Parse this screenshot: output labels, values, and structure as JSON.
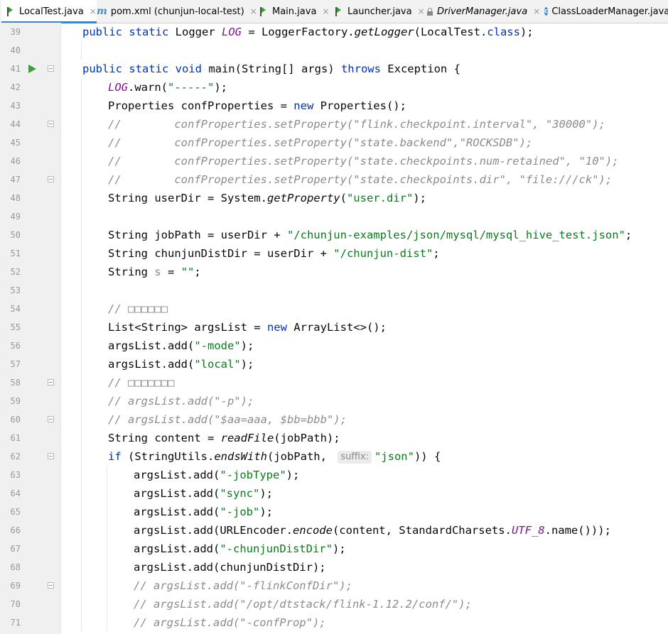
{
  "tabs": [
    {
      "label": "LocalTest.java",
      "icon": "java-class-icon",
      "active": true
    },
    {
      "label": "pom.xml (chunjun-local-test)",
      "icon": "maven-icon"
    },
    {
      "label": "Main.java",
      "icon": "java-class-icon"
    },
    {
      "label": "Launcher.java",
      "icon": "java-class-icon"
    },
    {
      "label": "DriverManager.java",
      "icon": "read-only-lock-icon"
    },
    {
      "label": "ClassLoaderManager.java",
      "icon": "class-icon"
    }
  ],
  "tab_close_glyph": "×",
  "code_lines": [
    {
      "n": "39",
      "t": [
        [
          "kw",
          "public static "
        ],
        [
          "plain",
          "Logger "
        ],
        [
          "fld",
          "LOG"
        ],
        [
          "plain",
          " = LoggerFactory."
        ],
        [
          "it",
          "getLogger"
        ],
        [
          "plain",
          "(LocalTest."
        ],
        [
          "kw",
          "class"
        ],
        [
          "plain",
          ");"
        ]
      ]
    },
    {
      "n": "40",
      "t": []
    },
    {
      "n": "41",
      "run": true,
      "fold": true,
      "t": [
        [
          "kw",
          "public static void "
        ],
        [
          "plain",
          "main(String[] args) "
        ],
        [
          "kw",
          "throws "
        ],
        [
          "plain",
          "Exception {"
        ]
      ]
    },
    {
      "n": "42",
      "t": [
        [
          "fld",
          "LOG"
        ],
        [
          "plain",
          ".warn("
        ],
        [
          "str",
          "\"-----\""
        ],
        [
          "plain",
          ");"
        ]
      ]
    },
    {
      "n": "43",
      "t": [
        [
          "plain",
          "Properties confProperties = "
        ],
        [
          "kw",
          "new "
        ],
        [
          "plain",
          "Properties();"
        ]
      ]
    },
    {
      "n": "44",
      "fold": true,
      "t": [
        [
          "cm",
          "//        confProperties.setProperty(\"flink.checkpoint.interval\", \"30000\");"
        ]
      ]
    },
    {
      "n": "45",
      "t": [
        [
          "cm",
          "//        confProperties.setProperty(\"state.backend\",\"ROCKSDB\");"
        ]
      ]
    },
    {
      "n": "46",
      "t": [
        [
          "cm",
          "//        confProperties.setProperty(\"state.checkpoints.num-retained\", \"10\");"
        ]
      ]
    },
    {
      "n": "47",
      "fold": true,
      "t": [
        [
          "cm",
          "//        confProperties.setProperty(\"state.checkpoints.dir\", \"file:///ck\");"
        ]
      ]
    },
    {
      "n": "48",
      "t": [
        [
          "plain",
          "String userDir = System."
        ],
        [
          "it",
          "getProperty"
        ],
        [
          "plain",
          "("
        ],
        [
          "str",
          "\"user.dir\""
        ],
        [
          "plain",
          ");"
        ]
      ]
    },
    {
      "n": "49",
      "t": []
    },
    {
      "n": "50",
      "t": [
        [
          "plain",
          "String jobPath = userDir + "
        ],
        [
          "str",
          "\"/chunjun-examples/json/mysql/mysql_hive_test.json\""
        ],
        [
          "plain",
          ";"
        ]
      ]
    },
    {
      "n": "51",
      "t": [
        [
          "plain",
          "String chunjunDistDir = userDir + "
        ],
        [
          "str",
          "\"/chunjun-dist\""
        ],
        [
          "plain",
          ";"
        ]
      ]
    },
    {
      "n": "52",
      "t": [
        [
          "plain",
          "String "
        ],
        [
          "param",
          "s"
        ],
        [
          "plain",
          " = "
        ],
        [
          "str",
          "\"\""
        ],
        [
          "plain",
          ";"
        ]
      ]
    },
    {
      "n": "53",
      "t": []
    },
    {
      "n": "54",
      "t": [
        [
          "cm",
          "// □□□□□□"
        ]
      ]
    },
    {
      "n": "55",
      "t": [
        [
          "plain",
          "List<String> argsList = "
        ],
        [
          "kw",
          "new "
        ],
        [
          "plain",
          "ArrayList<>();"
        ]
      ]
    },
    {
      "n": "56",
      "t": [
        [
          "plain",
          "argsList.add("
        ],
        [
          "str",
          "\"-mode\""
        ],
        [
          "plain",
          ");"
        ]
      ]
    },
    {
      "n": "57",
      "t": [
        [
          "plain",
          "argsList.add("
        ],
        [
          "str",
          "\"local\""
        ],
        [
          "plain",
          ");"
        ]
      ]
    },
    {
      "n": "58",
      "fold": true,
      "t": [
        [
          "cm",
          "// □□□□□□□"
        ]
      ]
    },
    {
      "n": "59",
      "t": [
        [
          "cm",
          "// argsList.add(\"-p\");"
        ]
      ]
    },
    {
      "n": "60",
      "fold": true,
      "t": [
        [
          "cm",
          "// argsList.add(\"$aa=aaa, $bb=bbb\");"
        ]
      ]
    },
    {
      "n": "61",
      "t": [
        [
          "plain",
          "String content = "
        ],
        [
          "it",
          "readFile"
        ],
        [
          "plain",
          "(jobPath);"
        ]
      ]
    },
    {
      "n": "62",
      "fold": true,
      "t": [
        [
          "kw",
          "if "
        ],
        [
          "plain",
          "(StringUtils."
        ],
        [
          "it",
          "endsWith"
        ],
        [
          "plain",
          "(jobPath, "
        ],
        [
          "hint",
          "suffix:"
        ],
        [
          "str",
          "\"json\""
        ],
        [
          "plain",
          ")) {"
        ]
      ]
    },
    {
      "n": "63",
      "t": [
        [
          "plain",
          "argsList.add("
        ],
        [
          "str",
          "\"-jobType\""
        ],
        [
          "plain",
          ");"
        ]
      ]
    },
    {
      "n": "64",
      "t": [
        [
          "plain",
          "argsList.add("
        ],
        [
          "str",
          "\"sync\""
        ],
        [
          "plain",
          ");"
        ]
      ]
    },
    {
      "n": "65",
      "t": [
        [
          "plain",
          "argsList.add("
        ],
        [
          "str",
          "\"-job\""
        ],
        [
          "plain",
          ");"
        ]
      ]
    },
    {
      "n": "66",
      "t": [
        [
          "plain",
          "argsList.add(URLEncoder."
        ],
        [
          "it",
          "encode"
        ],
        [
          "plain",
          "(content, StandardCharsets."
        ],
        [
          "fld",
          "UTF_8"
        ],
        [
          "plain",
          ".name()));"
        ]
      ]
    },
    {
      "n": "67",
      "t": [
        [
          "plain",
          "argsList.add("
        ],
        [
          "str",
          "\"-chunjunDistDir\""
        ],
        [
          "plain",
          ");"
        ]
      ]
    },
    {
      "n": "68",
      "t": [
        [
          "plain",
          "argsList.add(chunjunDistDir);"
        ]
      ]
    },
    {
      "n": "69",
      "fold": true,
      "t": [
        [
          "cm",
          "// argsList.add(\"-flinkConfDir\");"
        ]
      ]
    },
    {
      "n": "70",
      "t": [
        [
          "cm",
          "// argsList.add(\"/opt/dtstack/flink-1.12.2/conf/\");"
        ]
      ]
    },
    {
      "n": "71",
      "t": [
        [
          "cm",
          "// argsList.add(\"-confProp\");"
        ]
      ]
    }
  ]
}
